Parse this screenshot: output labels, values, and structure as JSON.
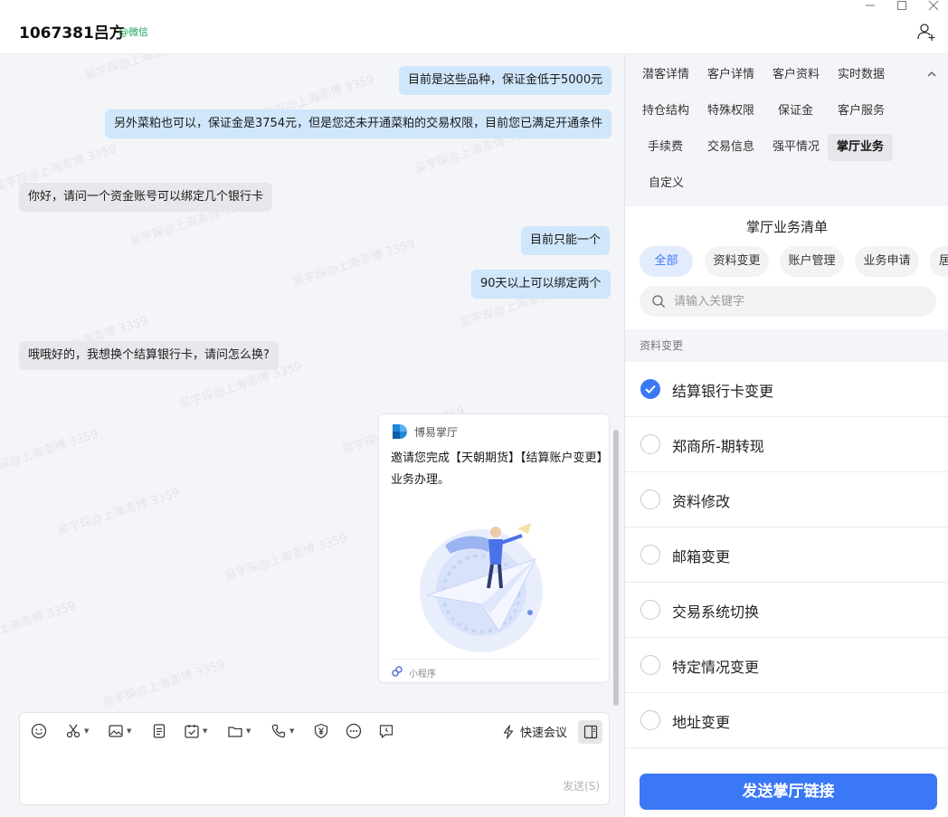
{
  "header": {
    "contact_name": "1067381吕方",
    "contact_source": "@微信",
    "window_controls": [
      "minimize",
      "maximize",
      "close"
    ],
    "add_member_icon": "add-user-icon"
  },
  "watermark": {
    "texts": [
      "吴宇琛@上海澎博 3359",
      "吴宇琛 13420133359"
    ]
  },
  "chat": {
    "messages": [
      {
        "side": "out",
        "text": "目前是这些品种，保证金低于5000元"
      },
      {
        "side": "out",
        "text": "另外菜粕也可以，保证金是3754元，但是您还未开通菜粕的交易权限，目前您已满足开通条件"
      },
      {
        "side": "in",
        "text": "你好，请问一个资金账号可以绑定几个银行卡"
      },
      {
        "side": "out",
        "text": "目前只能一个"
      },
      {
        "side": "out",
        "text": "90天以上可以绑定两个"
      },
      {
        "side": "in",
        "text": "哦哦好的，我想换个结算银行卡，请问怎么换?"
      }
    ],
    "card": {
      "app_name": "博易掌厅",
      "text": "邀请您完成【天朝期货】【结算账户变更】业务办理。",
      "footer": "小程序"
    }
  },
  "input": {
    "tools": [
      "emoji-icon",
      "scissors-icon",
      "image-icon",
      "document-icon",
      "calendar-check-icon",
      "folder-icon",
      "phone-icon",
      "yuan-shield-icon",
      "more-icon",
      "chat-time-icon"
    ],
    "quick_meeting": "快速会议",
    "send_label": "发送(S)"
  },
  "panel": {
    "tabs": [
      {
        "label": "潜客详情",
        "active": false
      },
      {
        "label": "客户详情",
        "active": false
      },
      {
        "label": "客户资料",
        "active": false
      },
      {
        "label": "实时数据",
        "active": false
      },
      {
        "label": "持仓结构",
        "active": false
      },
      {
        "label": "特殊权限",
        "active": false
      },
      {
        "label": "保证金",
        "active": false
      },
      {
        "label": "客户服务",
        "active": false
      },
      {
        "label": "手续费",
        "active": false
      },
      {
        "label": "交易信息",
        "active": false
      },
      {
        "label": "强平情况",
        "active": false
      },
      {
        "label": "掌厅业务",
        "active": true
      },
      {
        "label": "自定义",
        "active": false
      }
    ],
    "biz": {
      "title": "掌厅业务清单",
      "chips": [
        {
          "label": "全部",
          "active": true
        },
        {
          "label": "资料变更",
          "active": false
        },
        {
          "label": "账户管理",
          "active": false
        },
        {
          "label": "业务申请",
          "active": false
        },
        {
          "label": "居",
          "active": false
        }
      ],
      "search_placeholder": "请输入关键字",
      "group_label": "资料变更",
      "items": [
        {
          "label": "结算银行卡变更",
          "checked": true
        },
        {
          "label": "郑商所-期转现",
          "checked": false
        },
        {
          "label": "资料修改",
          "checked": false
        },
        {
          "label": "邮箱变更",
          "checked": false
        },
        {
          "label": "交易系统切换",
          "checked": false
        },
        {
          "label": "特定情况变更",
          "checked": false
        },
        {
          "label": "地址变更",
          "checked": false
        }
      ],
      "send_button": "发送掌厅链接"
    }
  },
  "colors": {
    "accent": "#3b78f6",
    "bubble_out": "#cfe6fb",
    "bubble_in": "#e7e8eb",
    "source_green": "#19a85a"
  }
}
